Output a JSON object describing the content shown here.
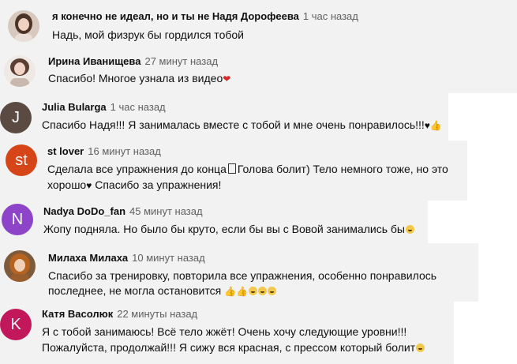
{
  "comments": [
    {
      "author": "я конечно не идеал, но и ты не Надя Дорофеева",
      "time": "1 час назад",
      "text": "Надь, мой физрук бы гордился тобой",
      "avatar_icon": "avatar-photo-icon"
    },
    {
      "author": "Ирина Иванищева",
      "time": "27 минут назад",
      "text": "Спасибо! Многое узнала из видео",
      "avatar_icon": "avatar-photo-icon"
    },
    {
      "author": "Julia Bularga",
      "time": "1 час назад",
      "text": "Спасибо Надя!!!  Я занималась вместе с тобой и мне очень понравилось!!!",
      "avatar_letter": "J",
      "avatar_color": "#5a4a42"
    },
    {
      "author": "st lover",
      "time": "16 минут назад",
      "text_line1": "Сделала все упражнения до конца",
      "text_line1b": "Голова болит) Тело немного тоже, но это",
      "text_line2": "хорошо",
      "text_line2b": "Спасибо за упражнения!",
      "avatar_letter": "st",
      "avatar_color": "#d64517"
    },
    {
      "author": "Nadya DoDo_fan",
      "time": "45 минут назад",
      "text": "Жопу подняла. Но было бы круто, если бы вы с Вовой занимались бы",
      "avatar_letter": "N",
      "avatar_color": "#8e44c8"
    },
    {
      "author": "Милаха Милаха",
      "time": "10 минут назад",
      "text_line1": "Спасибо за тренировку, повторила все упражнения, особенно понравилось",
      "text_line2": "последнее, не могла остановится",
      "avatar_icon": "avatar-photo-icon"
    },
    {
      "author": "Катя Васолюк",
      "time": "22 минуты назад",
      "text_line1": "Я с тобой занимаюсь! Всё тело жжёт! Очень хочу следующие уровни!!!",
      "text_line2": "Пожалуйста, продолжай!!! Я сижу вся красная, с прессом который болит",
      "avatar_letter": "K",
      "avatar_color": "#c2185b"
    }
  ],
  "colors": {
    "shade": "#f2f2f2",
    "author_text": "#0f0f0f",
    "time_text": "#606060",
    "heart_red": "#d42b2b"
  }
}
